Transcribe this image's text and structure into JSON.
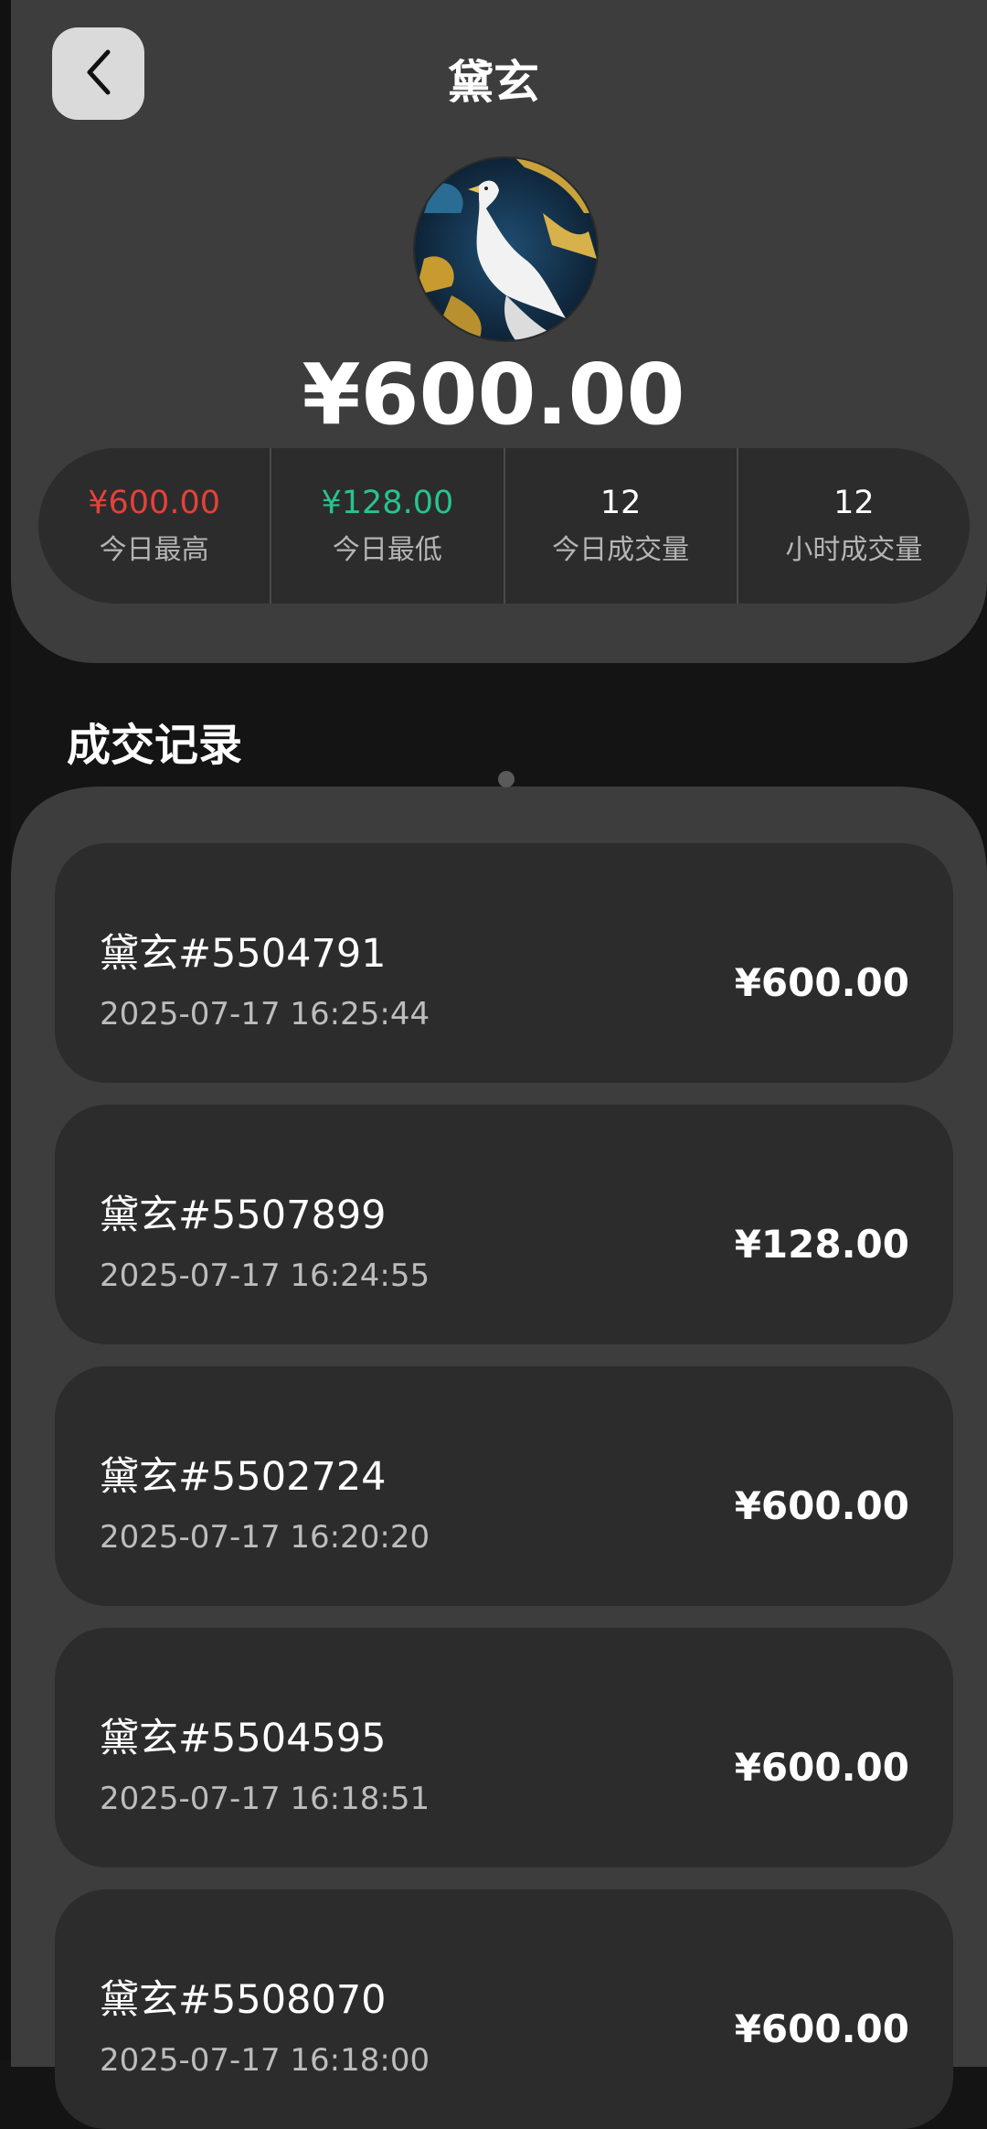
{
  "header": {
    "title": "黛玄",
    "price": "¥600.00"
  },
  "stats": [
    {
      "value": "¥600.00",
      "label": "今日最高",
      "color": "#e5413a"
    },
    {
      "value": "¥128.00",
      "label": "今日最低",
      "color": "#26c48e"
    },
    {
      "value": "12",
      "label": "今日成交量",
      "color": "#ffffff"
    },
    {
      "value": "12",
      "label": "小时成交量",
      "color": "#ffffff"
    }
  ],
  "section": {
    "title": "成交记录"
  },
  "records": [
    {
      "name": "黛玄#5504791",
      "time": "2025-07-17 16:25:44",
      "price": "¥600.00"
    },
    {
      "name": "黛玄#5507899",
      "time": "2025-07-17 16:24:55",
      "price": "¥128.00"
    },
    {
      "name": "黛玄#5502724",
      "time": "2025-07-17 16:20:20",
      "price": "¥600.00"
    },
    {
      "name": "黛玄#5504595",
      "time": "2025-07-17 16:18:51",
      "price": "¥600.00"
    },
    {
      "name": "黛玄#5508070",
      "time": "2025-07-17 16:18:00",
      "price": "¥600.00"
    }
  ]
}
